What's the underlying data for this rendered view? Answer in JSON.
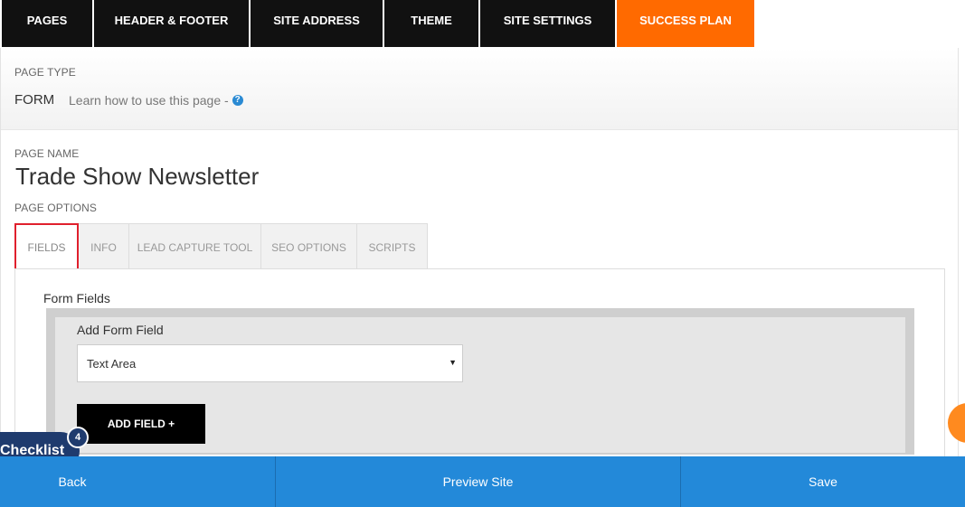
{
  "topnav": {
    "tabs": [
      {
        "label": "PAGES"
      },
      {
        "label": "HEADER & FOOTER"
      },
      {
        "label": "SITE ADDRESS"
      },
      {
        "label": "THEME"
      },
      {
        "label": "SITE SETTINGS"
      },
      {
        "label": "SUCCESS PLAN"
      }
    ]
  },
  "page_type": {
    "heading": "PAGE TYPE",
    "value": "FORM",
    "learn_text": "Learn how to use this page -",
    "help_glyph": "?"
  },
  "page_name": {
    "heading": "PAGE NAME",
    "value": "Trade Show Newsletter"
  },
  "page_options": {
    "heading": "PAGE OPTIONS",
    "tabs": [
      {
        "label": "FIELDS"
      },
      {
        "label": "INFO"
      },
      {
        "label": "LEAD CAPTURE TOOL"
      },
      {
        "label": "SEO OPTIONS"
      },
      {
        "label": "SCRIPTS"
      }
    ]
  },
  "fields_panel": {
    "title": "Form Fields",
    "add_label": "Add Form Field",
    "select_value": "Text Area",
    "caret": "▼",
    "add_button": "ADD FIELD +"
  },
  "checklist": {
    "label": "Checklist",
    "count": "4"
  },
  "bottombar": {
    "back": "Back",
    "preview": "Preview Site",
    "save": "Save"
  },
  "colors": {
    "nav_bg": "#111111",
    "accent_orange": "#ff6a00",
    "bottom_blue": "#2389d9",
    "checklist_navy": "#1f3b6e",
    "active_tab_outline": "#e0202d"
  }
}
